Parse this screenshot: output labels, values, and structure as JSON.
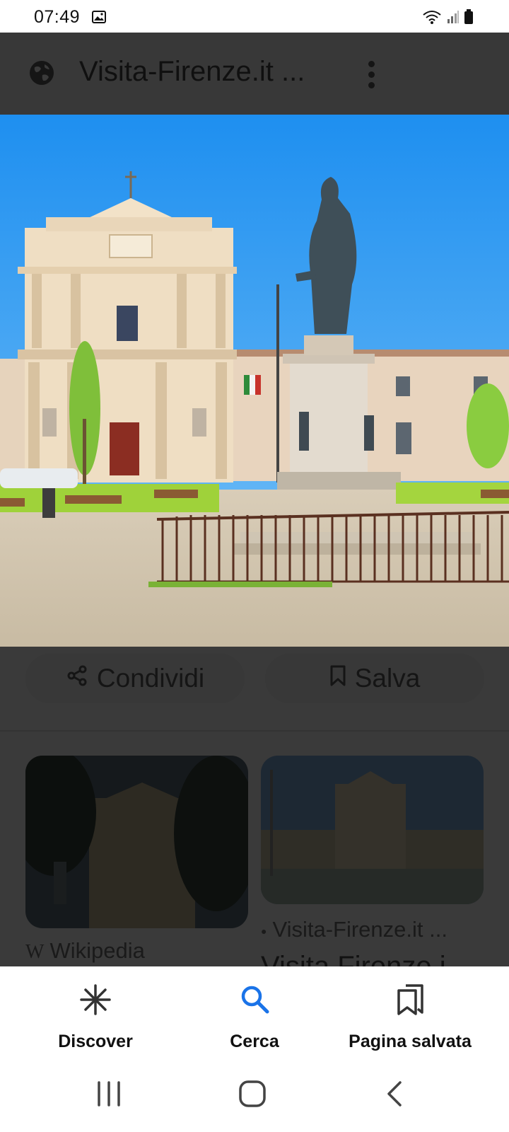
{
  "status_bar": {
    "time": "07:49",
    "icons": [
      "gallery-icon",
      "wifi-icon",
      "signal-icon",
      "battery-icon"
    ]
  },
  "app_bar": {
    "title": "Visita-Firenze.it ...",
    "icons": [
      "globe-icon",
      "more-vert-icon"
    ]
  },
  "actions": {
    "share_label": "Condividi",
    "save_label": "Salva"
  },
  "related": [
    {
      "source": "Wikipedia",
      "source_icon": "W"
    },
    {
      "source": "Visita-Firenze.it ...",
      "title": "Visita Firenze i"
    }
  ],
  "bottom_nav": {
    "items": [
      {
        "label": "Discover",
        "icon": "asterisk-icon",
        "active": false
      },
      {
        "label": "Cerca",
        "icon": "search-icon",
        "active": true
      },
      {
        "label": "Pagina salvata",
        "icon": "bookmarks-icon",
        "active": false
      }
    ]
  },
  "system_nav": [
    "recents-button",
    "home-button",
    "back-button"
  ],
  "colors": {
    "scrim": "#3a3a3a",
    "accent": "#1a73e8",
    "nav_bg": "#ffffff"
  }
}
